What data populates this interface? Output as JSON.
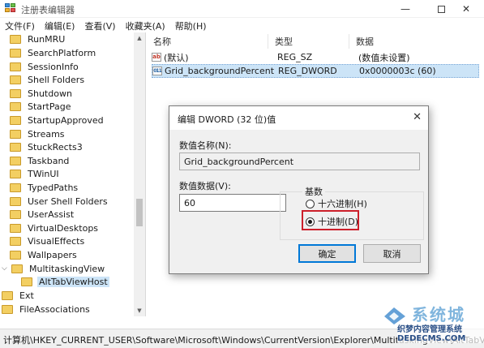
{
  "window": {
    "title": "注册表编辑器",
    "controls": {
      "minimize": "—",
      "maximize": "□",
      "close": "✕"
    }
  },
  "menu": [
    "文件(F)",
    "编辑(E)",
    "查看(V)",
    "收藏夹(A)",
    "帮助(H)"
  ],
  "tree": {
    "items": [
      {
        "label": "RunMRU"
      },
      {
        "label": "SearchPlatform"
      },
      {
        "label": "SessionInfo"
      },
      {
        "label": "Shell Folders"
      },
      {
        "label": "Shutdown"
      },
      {
        "label": "StartPage"
      },
      {
        "label": "StartupApproved"
      },
      {
        "label": "Streams"
      },
      {
        "label": "StuckRects3"
      },
      {
        "label": "Taskband"
      },
      {
        "label": "TWinUI"
      },
      {
        "label": "TypedPaths"
      },
      {
        "label": "User Shell Folders"
      },
      {
        "label": "UserAssist"
      },
      {
        "label": "VirtualDesktops"
      },
      {
        "label": "VisualEffects"
      },
      {
        "label": "Wallpapers"
      },
      {
        "label": "MultitaskingView",
        "expanded": true
      },
      {
        "label": "AltTabViewHost",
        "selected": true
      },
      {
        "label": "Ext"
      },
      {
        "label": "FileAssociations"
      }
    ]
  },
  "list": {
    "columns": [
      "名称",
      "类型",
      "数据"
    ],
    "rows": [
      {
        "icon": "string-value-icon",
        "name": "(默认)",
        "type": "REG_SZ",
        "data": "(数值未设置)"
      },
      {
        "icon": "dword-value-icon",
        "name": "Grid_backgroundPercent",
        "type": "REG_DWORD",
        "data": "0x0000003c (60)",
        "selected": true
      }
    ]
  },
  "status": {
    "path": "计算机\\HKEY_CURRENT_USER\\Software\\Microsoft\\Windows\\CurrentVersion\\Explorer\\MultitaskingView\\AltTabViewHost"
  },
  "dialog": {
    "title": "编辑 DWORD (32 位)值",
    "close": "✕",
    "name_label": "数值名称(N):",
    "name_value": "Grid_backgroundPercent",
    "data_label": "数值数据(V):",
    "data_value": "60",
    "base_label": "基数",
    "options": [
      {
        "label": "十六进制(H)",
        "checked": false
      },
      {
        "label": "十进制(D)",
        "checked": true
      }
    ],
    "ok": "确定",
    "cancel": "取消",
    "highlight_color": "#cc1f2a"
  },
  "watermark": {
    "brand": "系统城",
    "sub": "织梦内容管理系统",
    "domain": "DEDECMS.COM"
  },
  "colors": {
    "selection": "#cce4f7",
    "accent": "#0078d7"
  }
}
